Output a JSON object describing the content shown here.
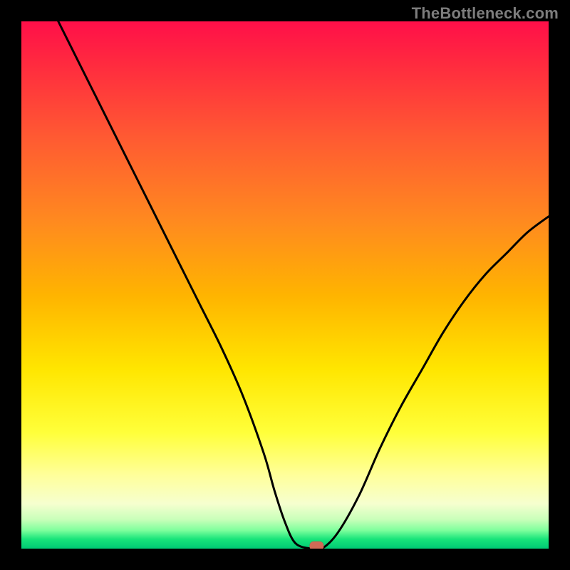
{
  "watermark": "TheBottleneck.com",
  "chart_data": {
    "type": "line",
    "title": "",
    "xlabel": "",
    "ylabel": "",
    "xlim": [
      0,
      100
    ],
    "ylim": [
      0,
      100
    ],
    "background_gradient": {
      "orientation": "vertical",
      "stops": [
        {
          "pos": 0,
          "color": "#ff0f49"
        },
        {
          "pos": 0.22,
          "color": "#ff5a32"
        },
        {
          "pos": 0.52,
          "color": "#ffb400"
        },
        {
          "pos": 0.78,
          "color": "#ffff3a"
        },
        {
          "pos": 0.92,
          "color": "#f6ffcf"
        },
        {
          "pos": 1.0,
          "color": "#00c974"
        }
      ]
    },
    "series": [
      {
        "name": "bottleneck-curve",
        "color": "#000000",
        "x": [
          7,
          10,
          14,
          18,
          22,
          26,
          30,
          34,
          38,
          42,
          46,
          48,
          50,
          52,
          55,
          57,
          60,
          64,
          68,
          72,
          76,
          80,
          84,
          88,
          92,
          96,
          100
        ],
        "y": [
          100,
          94,
          86,
          78,
          70,
          62,
          54,
          46,
          38,
          29,
          18,
          11,
          5,
          1,
          0,
          0,
          3,
          10,
          19,
          27,
          34,
          41,
          47,
          52,
          56,
          60,
          63
        ]
      }
    ],
    "marker": {
      "name": "optimal-point",
      "x": 56,
      "y": 0.5,
      "color": "#d06a56",
      "shape": "rounded-rect"
    }
  }
}
